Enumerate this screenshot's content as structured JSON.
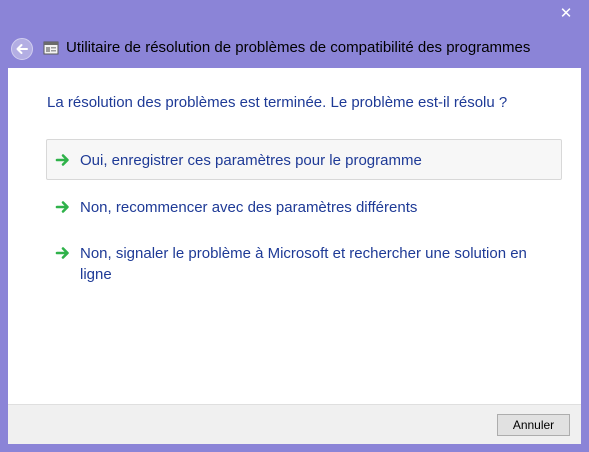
{
  "window": {
    "title": "Utilitaire de résolution de problèmes de compatibilité des programmes",
    "close_glyph": "✕"
  },
  "main": {
    "question": "La résolution des problèmes est terminée. Le problème est-il résolu ?",
    "options": [
      {
        "label": "Oui, enregistrer ces paramètres pour le programme",
        "selected": true
      },
      {
        "label": "Non, recommencer avec des paramètres différents",
        "selected": false
      },
      {
        "label": "Non, signaler le problème à Microsoft et rechercher une solution en ligne",
        "selected": false
      }
    ]
  },
  "footer": {
    "cancel_label": "Annuler"
  },
  "colors": {
    "frame": "#8b84d7",
    "link_text": "#1e3a96",
    "arrow_green": "#2fb24a"
  },
  "icons": {
    "back": "back-arrow-icon",
    "app": "compatibility-troubleshooter-icon",
    "option_arrow": "green-arrow-icon",
    "close": "close-icon"
  }
}
